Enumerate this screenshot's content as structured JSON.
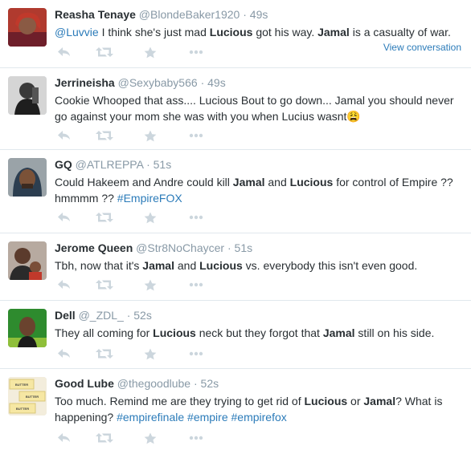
{
  "colors": {
    "link": "#2b7bb9",
    "muted": "#8899a6",
    "border": "#e1e8ed",
    "icon": "#ccd6dd"
  },
  "tweets": [
    {
      "fullname": "Reasha Tenaye",
      "username": "@BlondeBaker1920",
      "time": "49s",
      "avatar": "woman-red-hair-avatar",
      "parts": [
        {
          "t": "@Luvvie",
          "s": "link"
        },
        {
          "t": " I think she's just mad "
        },
        {
          "t": "Lucious",
          "s": "bold"
        },
        {
          "t": " got his way. "
        },
        {
          "t": "Jamal",
          "s": "bold"
        },
        {
          "t": " is a casualty of war."
        }
      ],
      "view_conversation": "View conversation"
    },
    {
      "fullname": "Jerrineisha",
      "username": "@Sexybaby566",
      "time": "49s",
      "avatar": "woman-bw-photo-avatar",
      "parts": [
        {
          "t": "Cookie Whooped that ass.... Lucious Bout to go down... Jamal you should never go against your mom she was with you when Lucius wasnt"
        },
        {
          "t": "😩",
          "s": "emoji"
        }
      ]
    },
    {
      "fullname": "GQ",
      "username": "@ATLREPPA",
      "time": "51s",
      "avatar": "man-hoodie-avatar",
      "parts": [
        {
          "t": "Could Hakeem and Andre could kill "
        },
        {
          "t": "Jamal",
          "s": "bold"
        },
        {
          "t": "  and "
        },
        {
          "t": "Lucious",
          "s": "bold"
        },
        {
          "t": " for control of Empire ?? hmmmm ?? "
        },
        {
          "t": "#EmpireFOX",
          "s": "link"
        }
      ]
    },
    {
      "fullname": "Jerome Queen",
      "username": "@Str8NoChaycer",
      "time": "51s",
      "avatar": "man-with-child-avatar",
      "parts": [
        {
          "t": "Tbh, now that it's "
        },
        {
          "t": "Jamal",
          "s": "bold"
        },
        {
          "t": " and "
        },
        {
          "t": "Lucious",
          "s": "bold"
        },
        {
          "t": " vs. everybody this isn't even good."
        }
      ]
    },
    {
      "fullname": "Dell",
      "username": "@_ZDL_",
      "time": "52s",
      "avatar": "man-green-background-avatar",
      "parts": [
        {
          "t": "They all coming for "
        },
        {
          "t": "Lucious",
          "s": "bold"
        },
        {
          "t": " neck but they forgot that "
        },
        {
          "t": "Jamal",
          "s": "bold"
        },
        {
          "t": " still on his side."
        }
      ]
    },
    {
      "fullname": "Good Lube",
      "username": "@thegoodlube",
      "time": "52s",
      "avatar": "butter-sticks-avatar",
      "avatar_text": "BUTTER",
      "parts": [
        {
          "t": "Too much. Remind me are they trying to get rid of "
        },
        {
          "t": "Lucious",
          "s": "bold"
        },
        {
          "t": " or "
        },
        {
          "t": "Jamal",
          "s": "bold"
        },
        {
          "t": "? What is happening? "
        },
        {
          "t": "#empirefinale",
          "s": "link"
        },
        {
          "t": " "
        },
        {
          "t": "#empire",
          "s": "link"
        },
        {
          "t": " "
        },
        {
          "t": "#empirefox",
          "s": "link"
        }
      ]
    }
  ],
  "actions": [
    "reply-icon",
    "retweet-icon",
    "favorite-icon",
    "more-icon"
  ]
}
